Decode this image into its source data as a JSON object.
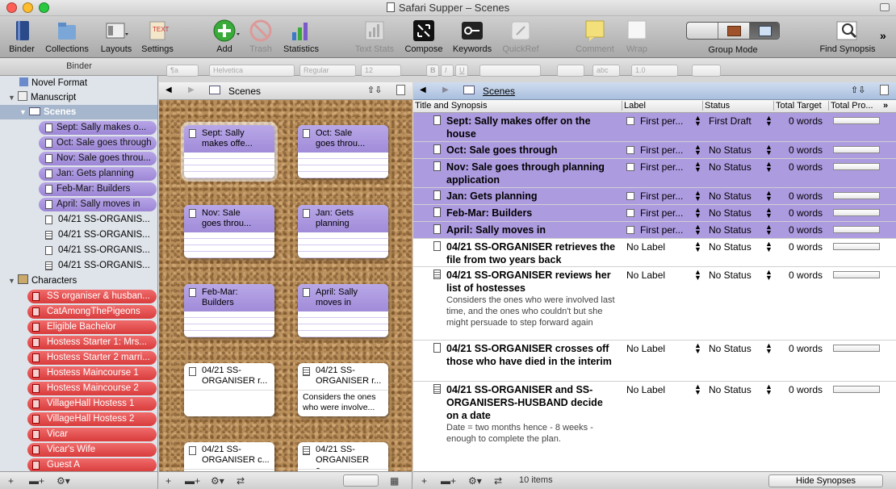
{
  "window": {
    "title": "Safari Supper – Scenes",
    "colors": {
      "close": "#ff5f57",
      "minimize": "#febc2e",
      "zoom": "#28c840"
    }
  },
  "toolbar": {
    "binder": "Binder",
    "collections": "Collections",
    "layouts": "Layouts",
    "settings": "Settings",
    "add": "Add",
    "trash": "Trash",
    "statistics": "Statistics",
    "text_stats": "Text Stats",
    "compose": "Compose",
    "keywords": "Keywords",
    "quickref": "QuickRef",
    "comment": "Comment",
    "wrap": "Wrap",
    "group_mode": "Group Mode",
    "find_synopsis": "Find Synopsis",
    "more": "»"
  },
  "format_bar": {
    "style": "¶a",
    "font": "Helvetica",
    "weight": "Regular",
    "size": "12",
    "bold": "B",
    "italic": "I",
    "underline": "U",
    "abc": "abc",
    "spacing": "1.0"
  },
  "binder": {
    "header": "Binder",
    "novel_format": "Novel Format",
    "manuscript": "Manuscript",
    "scenes": "Scenes",
    "scene_items": [
      "Sept: Sally makes o...",
      "Oct: Sale goes through",
      "Nov: Sale goes throu...",
      "Jan: Gets planning",
      "Feb-Mar: Builders",
      "April: Sally moves in"
    ],
    "doc_items": [
      "04/21 SS-ORGANIS...",
      "04/21 SS-ORGANIS...",
      "04/21 SS-ORGANIS...",
      "04/21 SS-ORGANIS..."
    ],
    "characters": "Characters",
    "character_items": [
      "SS organiser & husban...",
      "CatAmongThePigeons",
      "Eligible Bachelor",
      "Hostess Starter 1: Mrs...",
      "Hostess Starter 2 marri...",
      "Hostess Maincourse 1",
      "Hostess Maincourse 2",
      "VillageHall Hostess 1",
      "VillageHall Hostess 2",
      "Vicar",
      "Vicar's Wife",
      "Guest A"
    ]
  },
  "corkboard": {
    "title": "Scenes",
    "cards": [
      {
        "line1": "Sept: Sally",
        "line2": "makes offe...",
        "body": ""
      },
      {
        "line1": "Oct: Sale",
        "line2": "goes throu...",
        "body": ""
      },
      {
        "line1": "Nov: Sale",
        "line2": "goes throu...",
        "body": ""
      },
      {
        "line1": "Jan: Gets",
        "line2": "planning",
        "body": ""
      },
      {
        "line1": "Feb-Mar:",
        "line2": "Builders",
        "body": ""
      },
      {
        "line1": "April: Sally",
        "line2": "moves in",
        "body": ""
      },
      {
        "line1": "04/21 SS-",
        "line2": "ORGANISER r...",
        "body": ""
      },
      {
        "line1": "04/21 SS-",
        "line2": "ORGANISER r...",
        "body": "Considers the ones who were involve..."
      },
      {
        "line1": "04/21 SS-",
        "line2": "ORGANISER c...",
        "body": ""
      },
      {
        "line1": "04/21 SS-",
        "line2": "ORGANISER a...",
        "body": ""
      }
    ]
  },
  "outliner": {
    "title": "Scenes",
    "columns": {
      "title": "Title and Synopsis",
      "label": "Label",
      "status": "Status",
      "target": "Total Target",
      "progress": "Total Pro...",
      "more": "»"
    },
    "rows": [
      {
        "title": "Sept: Sally makes offer on the house",
        "synopsis": "",
        "label": "First per...",
        "status": "First Draft",
        "words": "0 words"
      },
      {
        "title": "Oct: Sale goes through",
        "synopsis": "",
        "label": "First per...",
        "status": "No Status",
        "words": "0 words"
      },
      {
        "title": "Nov: Sale goes through planning application",
        "synopsis": "",
        "label": "First per...",
        "status": "No Status",
        "words": "0 words"
      },
      {
        "title": "Jan: Gets planning",
        "synopsis": "",
        "label": "First per...",
        "status": "No Status",
        "words": "0 words"
      },
      {
        "title": "Feb-Mar: Builders",
        "synopsis": "",
        "label": "First per...",
        "status": "No Status",
        "words": "0 words"
      },
      {
        "title": "April: Sally moves in",
        "synopsis": "",
        "label": "First per...",
        "status": "No Status",
        "words": "0 words"
      },
      {
        "title": "04/21 SS-ORGANISER retrieves the file from two years back",
        "synopsis": "",
        "label": "No Label",
        "status": "No Status",
        "words": "0 words"
      },
      {
        "title": "04/21 SS-ORGANISER reviews her list of hostesses",
        "synopsis": "Considers the ones who were involved last time, and the ones who couldn't but she might persuade to step forward again",
        "label": "No Label",
        "status": "No Status",
        "words": "0 words"
      },
      {
        "title": "04/21 SS-ORGANISER crosses off those who have died in the interim",
        "synopsis": "",
        "label": "No Label",
        "status": "No Status",
        "words": "0 words"
      },
      {
        "title": "04/21 SS-ORGANISER and SS-ORGANISERS-HUSBAND decide on a date",
        "synopsis": "Date = two months hence - 8 weeks - enough to complete the plan.",
        "label": "No Label",
        "status": "No Status",
        "words": "0 words"
      }
    ],
    "item_count": "10 items",
    "hide_synopses": "Hide Synopses"
  },
  "colors": {
    "purple_label": "#ad9be0",
    "red_label": "#e04545",
    "selection": "#a9bfde"
  }
}
